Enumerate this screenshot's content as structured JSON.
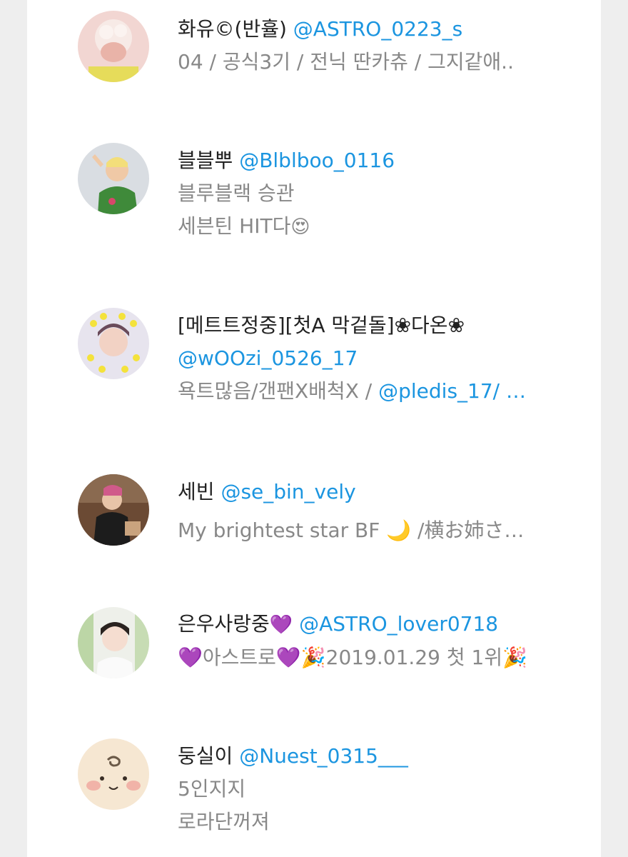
{
  "colors": {
    "handle": "#1b95e0",
    "name": "#222222",
    "bio": "#888888",
    "page_bg": "#eeeeee",
    "panel_bg": "#ffffff"
  },
  "users": [
    {
      "name": "화유©(반휼)",
      "handle": "@ASTRO_0223_s",
      "bio_lines": [
        "04 / 공식3기 / 전닉 딴카츄 / 그지같애.."
      ]
    },
    {
      "name": "블블뿌",
      "handle": "@Blblboo_0116",
      "bio_lines": [
        "블루블랙 승관",
        "세븐틴 HIT다"
      ],
      "bio_emoji": "😍"
    },
    {
      "name": "[메트트정중][첫A 막겉돌]❀다온❀",
      "handle": "@wOOzi_0526_17",
      "bio_prefix": "욕트많음/갠팬X배척X / ",
      "bio_mention": "@pledis_17/ …"
    },
    {
      "name": "세빈",
      "handle": "@se_bin_vely",
      "bio_lines": [
        "My brightest star BF 🌙 /横お姉さ…"
      ]
    },
    {
      "name": "은우사랑중",
      "name_emoji": "💜",
      "handle": "@ASTRO_lover0718",
      "bio_lines": [
        "💜아스트로💜🎉2019.01.29 첫 1위🎉"
      ]
    },
    {
      "name": "둥실이",
      "handle": "@Nuest_0315___",
      "bio_lines": [
        "5인지지",
        "로라단꺼져"
      ]
    }
  ]
}
